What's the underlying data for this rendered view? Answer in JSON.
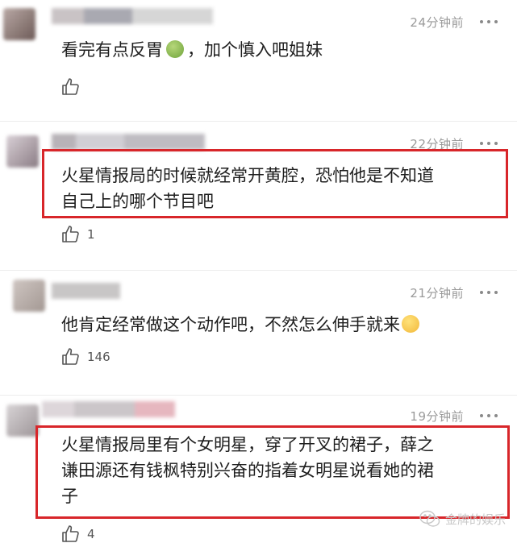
{
  "comments": [
    {
      "time": "24分钟前",
      "lines": [
        "看完有点反胃",
        "，加个慎入吧姐妹"
      ],
      "emoji": "nauseated-face-emoji",
      "likes": ""
    },
    {
      "time": "22分钟前",
      "lines": [
        "火星情报局的时候就经常开黄腔，恐怕他是不知道",
        "自己上的哪个节目吧"
      ],
      "likes": "1"
    },
    {
      "time": "21分钟前",
      "lines": [
        "他肯定经常做这个动作吧，不然怎么伸手就来"
      ],
      "emoji": "eye-roll-emoji",
      "likes": "146"
    },
    {
      "time": "19分钟前",
      "lines": [
        "火星情报局里有个女明星，穿了开叉的裙子，薛之",
        "谦田源还有钱枫特别兴奋的指着女明星说看她的裙",
        "子"
      ],
      "likes": "4"
    }
  ],
  "watermark": {
    "text": "金牌的娱乐",
    "icon": "wechat-icon"
  },
  "colors": {
    "highlight": "#d8262a",
    "timestamp": "#9a9a9a"
  }
}
